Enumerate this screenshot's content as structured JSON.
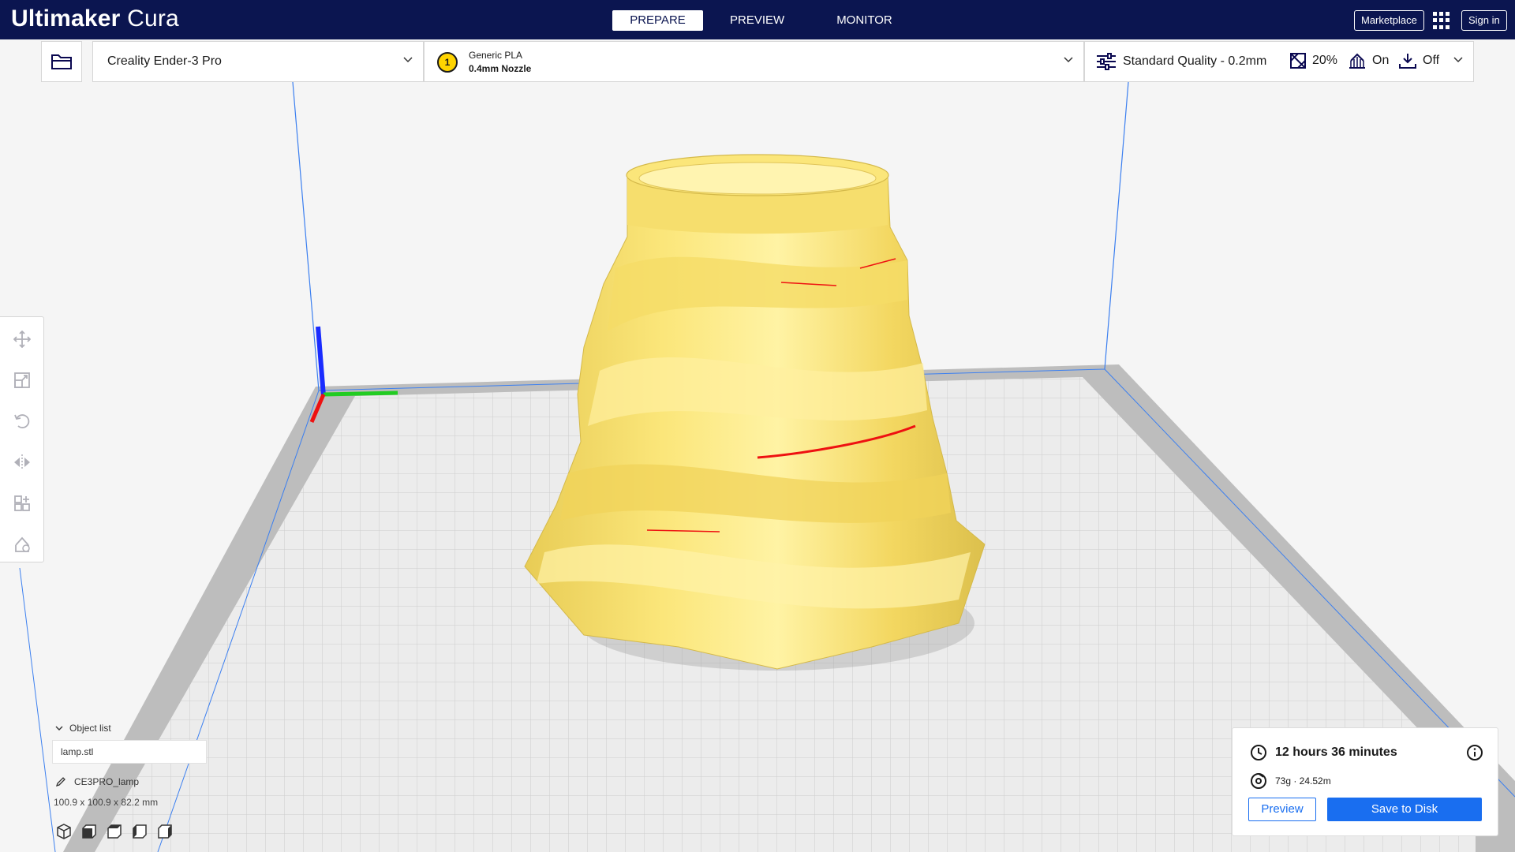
{
  "header": {
    "title_bold": "Ultimaker",
    "title_light": "Cura",
    "stages": [
      "PREPARE",
      "PREVIEW",
      "MONITOR"
    ],
    "marketplace_label": "Marketplace",
    "signin_label": "Sign in"
  },
  "toolbar": {
    "printer_name": "Creality Ender-3 Pro",
    "extruder_number": "1",
    "material_name": "Generic PLA",
    "nozzle": "0.4mm Nozzle",
    "quality": "Standard Quality - 0.2mm",
    "infill": "20%",
    "support": "On",
    "adhesion": "Off"
  },
  "object_list": {
    "header_label": "Object list",
    "items": [
      "lamp.stl"
    ],
    "object_name": "CE3PRO_lamp",
    "dimensions": "100.9 x 100.9 x 82.2 mm"
  },
  "action_panel": {
    "print_time": "12 hours 36 minutes",
    "material_usage": "73g · 24.52m",
    "preview_label": "Preview",
    "save_label": "Save to Disk"
  },
  "colors": {
    "header_bg": "#0b1550",
    "accent": "#196ef0",
    "model": "#fbe67a",
    "extruder": "#ffd400"
  }
}
